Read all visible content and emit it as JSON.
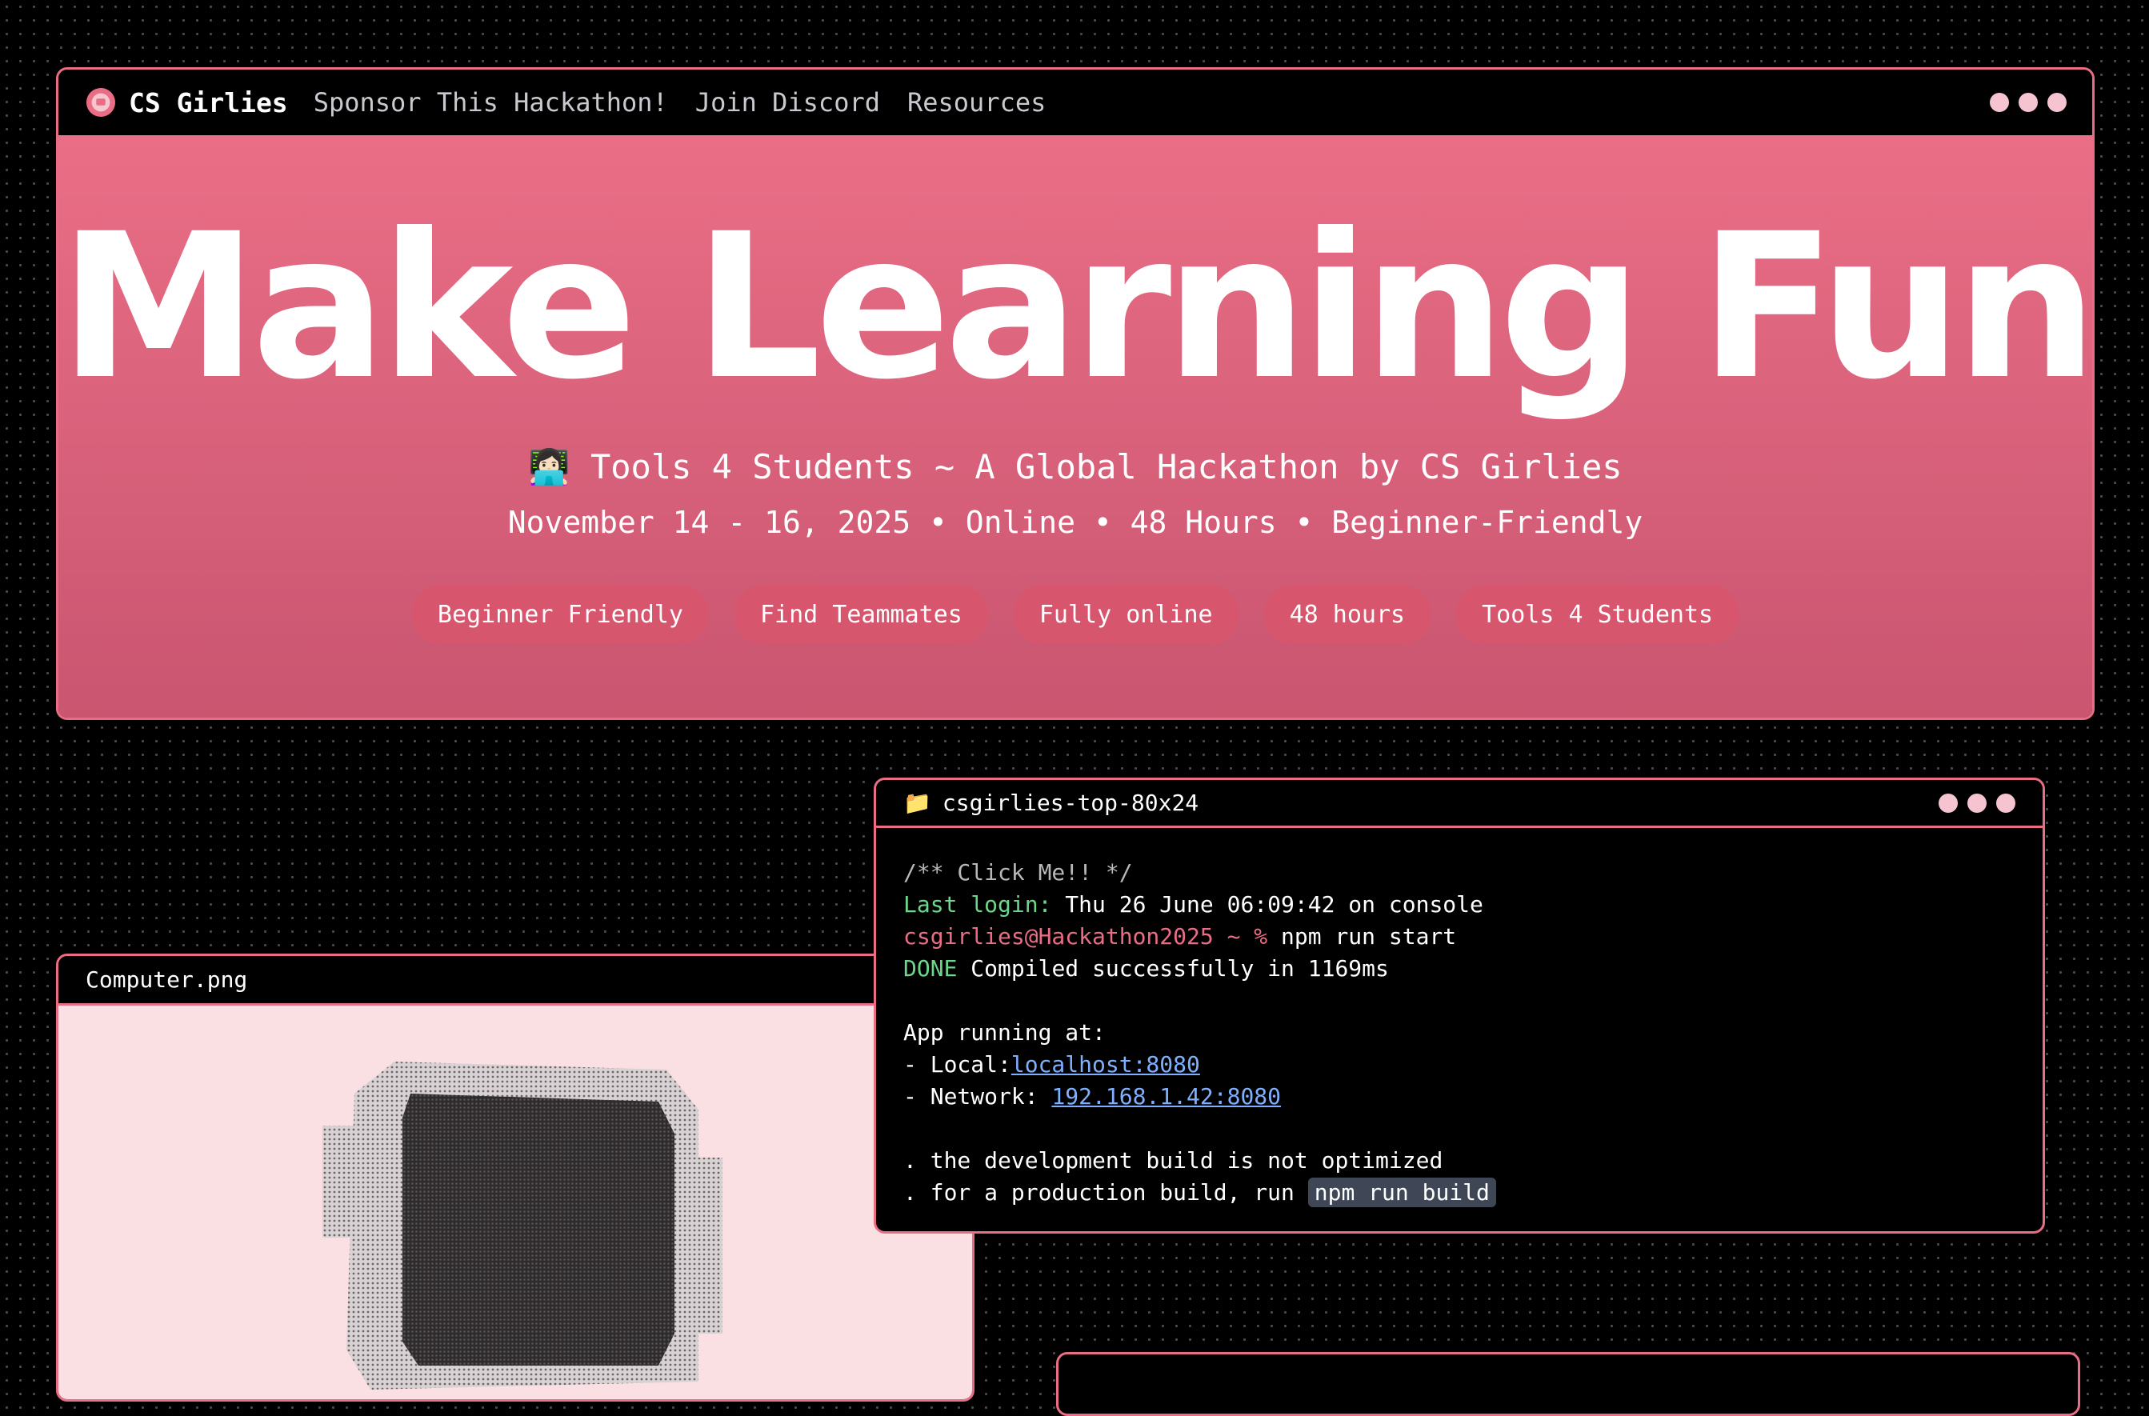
{
  "nav": {
    "brand": "CS Girlies",
    "links": [
      "Sponsor This Hackathon!",
      "Join Discord",
      "Resources"
    ]
  },
  "hero": {
    "headline": "Make Learning Fun",
    "subtitle": "👩🏻‍💻 Tools 4 Students ~ A Global Hackathon by CS Girlies",
    "details": "November 14 - 16, 2025 • Online • 48 Hours • Beginner-Friendly",
    "chips": [
      "Beginner Friendly",
      "Find Teammates",
      "Fully online",
      "48 hours",
      "Tools 4 Students"
    ]
  },
  "computer_window": {
    "title": "Computer.png"
  },
  "terminal": {
    "title": "csgirlies-top-80x24",
    "comment": "/** Click Me!! */",
    "last_login_label": "Last login:",
    "last_login_value": " Thu 26 June 06:09:42 on console",
    "prompt": "csgirlies@Hackathon2025 ~ %",
    "command": " npm run start",
    "done_label": "DONE",
    "done_text": " Compiled successfully in 1169ms",
    "app_running": "App running at:",
    "local_label": "- Local:",
    "local_url": "localhost:8080",
    "network_label": "- Network: ",
    "network_url": "192.168.1.42:8080",
    "note1": ". the development build is not optimized",
    "note2": ". for a production build, run ",
    "build_cmd": "npm run build"
  },
  "colors": {
    "accent": "#e96e85",
    "hero_gradient_top": "#ea6e86",
    "hero_gradient_bottom": "#c95570",
    "terminal_green": "#6cd68a",
    "link_blue": "#7fb0ff"
  }
}
